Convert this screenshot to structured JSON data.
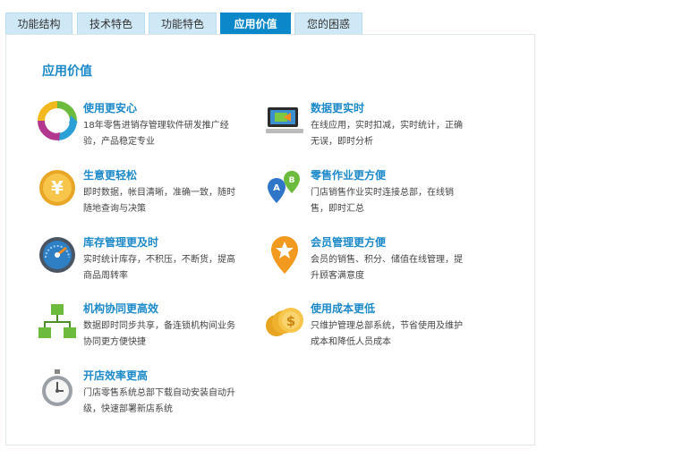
{
  "tabs": [
    "功能结构",
    "技术特色",
    "功能特色",
    "应用价值",
    "您的困惑"
  ],
  "active_tab": "应用价值",
  "section_title": "应用价值",
  "features": [
    {
      "title": "使用更安心",
      "desc": "18年零售进销存管理软件研发推广经验，产品稳定专业",
      "icon": "cycle-arrows-icon"
    },
    {
      "title": "数据更实时",
      "desc": "在线应用，实时扣减，实时统计，正确无误，即时分析",
      "icon": "computer-screen-icon"
    },
    {
      "title": "生意更轻松",
      "desc": "即时数据，帐目清晰，准确一致，随时随地查询与决策",
      "icon": "yen-coin-icon"
    },
    {
      "title": "零售作业更方便",
      "desc": "门店销售作业实时连接总部，在线销售，即时汇总",
      "icon": "ab-map-pins-icon"
    },
    {
      "title": "库存管理更及时",
      "desc": "实时统计库存，不积压，不断货，提高商品周转率",
      "icon": "gauge-meter-icon"
    },
    {
      "title": "会员管理更方便",
      "desc": "会员的销售、积分、储值在线管理，提升顾客满意度",
      "icon": "star-map-pin-icon"
    },
    {
      "title": "机构协同更高效",
      "desc": "数据即时同步共享，备连锁机构间业务协同更方便快捷",
      "icon": "org-chart-icon"
    },
    {
      "title": "使用成本更低",
      "desc": "只维护管理总部系统，节省使用及维护成本和降低人员成本",
      "icon": "coin-stack-icon"
    },
    {
      "title": "开店效率更高",
      "desc": "门店零售系统总部下载自动安装自动升级，快速部署新店系统",
      "icon": "stopwatch-icon"
    }
  ]
}
